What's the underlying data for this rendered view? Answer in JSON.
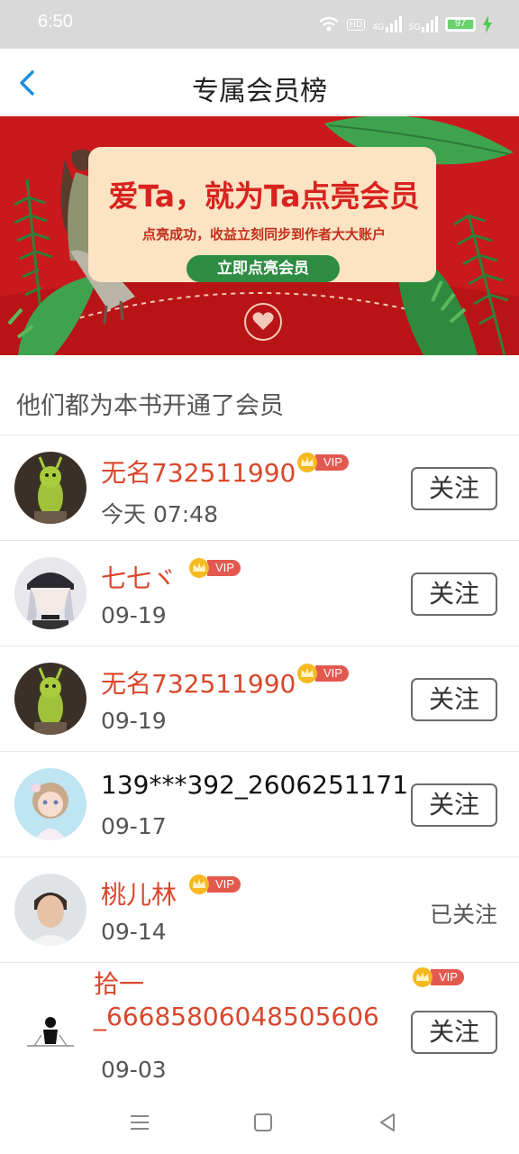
{
  "status_bar": {
    "time": "6:50",
    "battery": "97",
    "net_1": "4G",
    "net_2": "5G",
    "hd": "HD"
  },
  "header": {
    "title": "专属会员榜"
  },
  "banner": {
    "headline": "爱Ta，就为Ta点亮会员",
    "subline": "点亮成功，收益立刻同步到作者大大账户",
    "cta": "立即点亮会员"
  },
  "section": {
    "heading": "他们都为本书开通了会员"
  },
  "members": [
    {
      "name": "无名732511990",
      "date": "今天 07:48",
      "vip": "VIP",
      "action": "关注"
    },
    {
      "name": "七七ヾ",
      "date": "09-19",
      "vip": "VIP",
      "action": "关注"
    },
    {
      "name": "无名732511990",
      "date": "09-19",
      "vip": "VIP",
      "action": "关注"
    },
    {
      "name": "139***392_2606251171",
      "date": "09-17",
      "action": "关注"
    },
    {
      "name": "桃儿林",
      "date": "09-14",
      "vip": "VIP",
      "action": "已关注"
    },
    {
      "name": "拾一_66685806048505606",
      "date": "09-03",
      "vip": "VIP",
      "action": "关注"
    }
  ],
  "colors": {
    "accent_red": "#d9472b",
    "banner_red": "#c9191c",
    "vip_tag": "#e4594f",
    "back_blue": "#1e90e0"
  }
}
